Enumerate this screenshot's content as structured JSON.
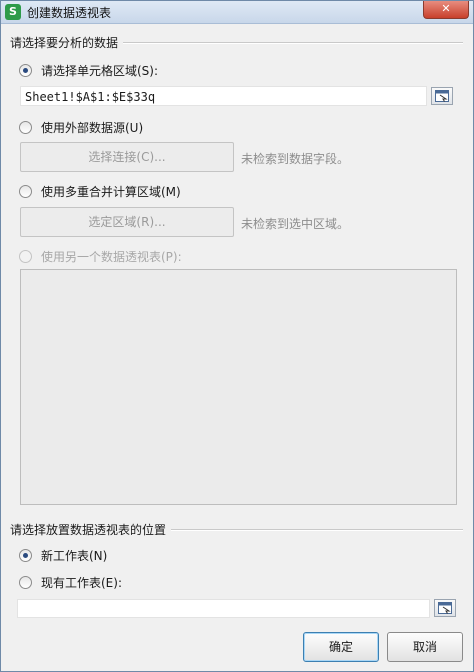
{
  "window": {
    "title": "创建数据透视表",
    "app_icon": "S",
    "close": "✕"
  },
  "source_section": {
    "heading": "请选择要分析的数据",
    "option_range": {
      "label": "请选择单元格区域(S):",
      "checked": true
    },
    "range_value": "Sheet1!$A$1:$E$33q",
    "option_external": {
      "label": "使用外部数据源(U)",
      "checked": false
    },
    "select_connection_button": "选择连接(C)...",
    "no_fields_hint": "未检索到数据字段。",
    "option_consolidate": {
      "label": "使用多重合并计算区域(M)",
      "checked": false
    },
    "select_region_button": "选定区域(R)...",
    "no_region_hint": "未检索到选中区域。",
    "option_other_pivot": {
      "label": "使用另一个数据透视表(P):",
      "checked": false,
      "disabled": true
    }
  },
  "target_section": {
    "heading": "请选择放置数据透视表的位置",
    "option_new_sheet": {
      "label": "新工作表(N)",
      "checked": true
    },
    "option_existing_sheet": {
      "label": "现有工作表(E):",
      "checked": false
    },
    "existing_value": ""
  },
  "buttons": {
    "ok": "确定",
    "cancel": "取消"
  },
  "icons": {
    "range_picker": "range-picker-icon"
  }
}
